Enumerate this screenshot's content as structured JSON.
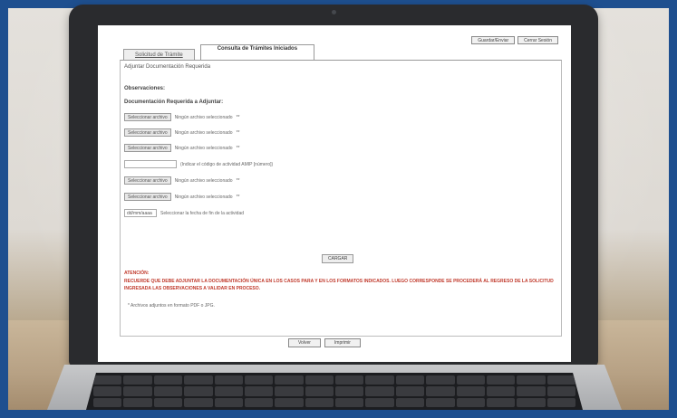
{
  "tabs": [
    {
      "label": "Solicitud de Trámite"
    },
    {
      "label": "Consulta de Trámites Iniciados"
    }
  ],
  "top_buttons": [
    {
      "label": "Guardar/Enviar"
    },
    {
      "label": "Cerrar Sesión"
    }
  ],
  "form": {
    "subtitle": "Adjuntar Documentación Requerida",
    "observaciones": "Observaciones:",
    "doc_heading": "Documentación Requerida a Adjuntar:",
    "file_button": "Seleccionar archivo",
    "no_file": "Ningún archivo seleccionado",
    "asterisks": "**",
    "code_hint": "(Indicar el código de actividad AMIP [número])",
    "date_value": "dd/mm/aaaa",
    "date_hint": "Seleccionar la fecha de fin de la actividad",
    "cargar": "CARGAR",
    "atencion_title": "ATENCIÓN:",
    "atencion_text": "RECUERDE QUE DEBE ADJUNTAR LA DOCUMENTACIÓN ÚNICA EN LOS CASOS PARA Y EN LOS FORMATOS INDICADOS. LUEGO CORRESPONDE SE PROCEDERÁ AL REGRESO DE LA SOLICITUD INGRESADA LAS OBSERVACIONES A VALIDAR EN PROCESO.",
    "footnote": "* Archivos adjuntos en formato PDF o JPG."
  },
  "bottom_buttons": [
    {
      "label": "Volver"
    },
    {
      "label": "Imprimir"
    }
  ]
}
